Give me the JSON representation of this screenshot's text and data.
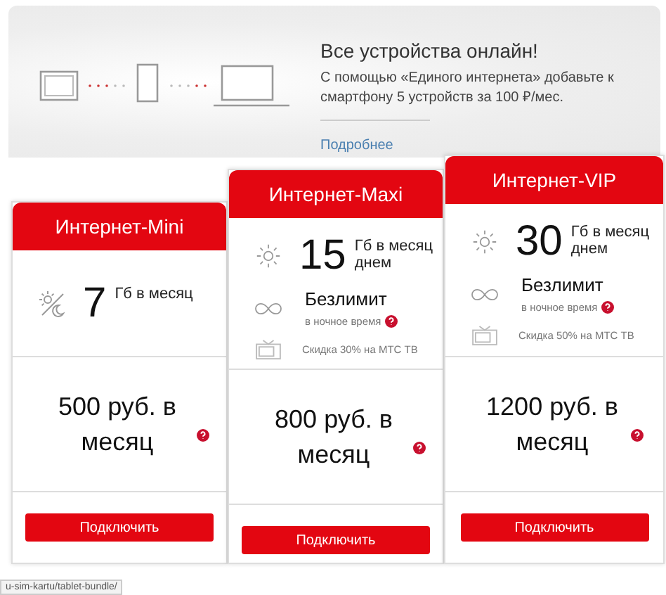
{
  "banner": {
    "title": "Все устройства онлайн!",
    "text": "С помощью «Единого интернета» добавьте к смартфону 5 устройств за 100 ₽/мес.",
    "link": "Подробнее"
  },
  "plans": [
    {
      "name": "Интернет-Mini",
      "features": [
        {
          "kind": "volume_day_night",
          "amount": "7",
          "unit": "Гб в месяц"
        }
      ],
      "price": "500 руб. в месяц",
      "button": "Подключить"
    },
    {
      "name": "Интернет-Maxi",
      "features": [
        {
          "kind": "volume_day",
          "amount": "15",
          "unit": "Гб в месяц днем"
        },
        {
          "kind": "unlimited",
          "title": "Безлимит",
          "note": "в ночное время"
        },
        {
          "kind": "tv",
          "text": "Скидка 30% на МТС ТВ"
        }
      ],
      "price": "800 руб. в месяц",
      "button": "Подключить"
    },
    {
      "name": "Интернет-VIP",
      "features": [
        {
          "kind": "volume_day",
          "amount": "30",
          "unit": "Гб в месяц днем"
        },
        {
          "kind": "unlimited",
          "title": "Безлимит",
          "note": "в ночное время"
        },
        {
          "kind": "tv",
          "text": "Скидка 50% на МТС ТВ"
        }
      ],
      "price": "1200 руб. в месяц",
      "button": "Подключить"
    }
  ],
  "status_bar": {
    "url": "u-sim-kartu/tablet-bundle/"
  }
}
